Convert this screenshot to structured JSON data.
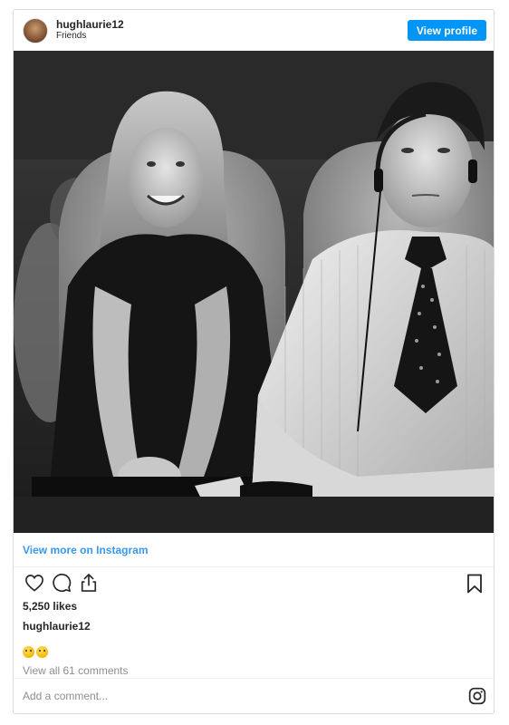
{
  "header": {
    "username": "hughlaurie12",
    "subtitle": "Friends",
    "view_profile_label": "View profile"
  },
  "post": {
    "view_more_label": "View more on Instagram",
    "likes_text": "5,250 likes",
    "caption_username": "hughlaurie12",
    "caption_emojis": [
      "zany-face-emoji",
      "zany-face-emoji"
    ],
    "comments_link": "View all 61 comments"
  },
  "comment_box": {
    "placeholder": "Add a comment..."
  },
  "icons": {
    "like": "heart-icon",
    "comment": "comment-icon",
    "share": "share-icon",
    "save": "bookmark-icon",
    "brand": "instagram-icon"
  },
  "colors": {
    "button_blue": "#0095f6",
    "link_blue": "#3897f0",
    "muted_text": "#8e8e8e"
  }
}
